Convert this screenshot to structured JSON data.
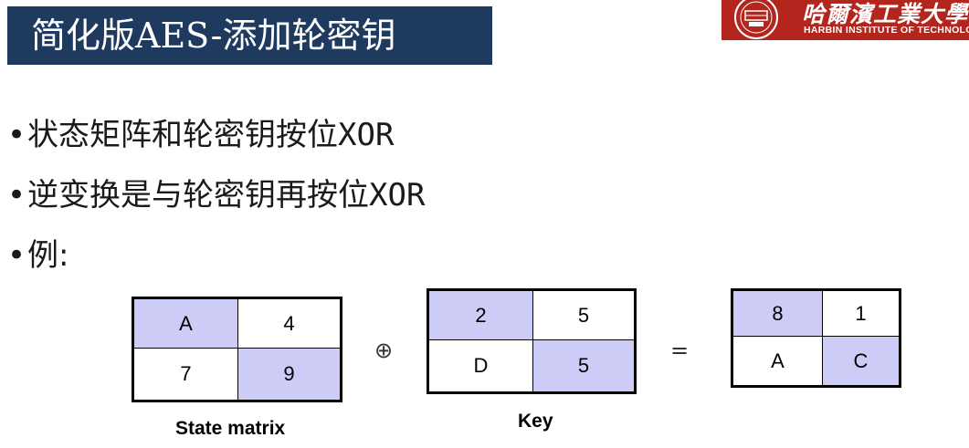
{
  "title": "简化版AES-添加轮密钥",
  "logo": {
    "cn": "哈爾濱工業大學",
    "en": "HARBIN INSTITUTE OF TECHNOLOGY"
  },
  "bullets": [
    {
      "cn": "状态矩阵和轮密钥按位",
      "en": "XOR"
    },
    {
      "cn": "逆变换是与轮密钥再按位",
      "en": "XOR"
    },
    {
      "cn": "例:",
      "en": ""
    }
  ],
  "bullet_symbol": "•",
  "colors": {
    "title_bg": "#1f3a5f",
    "logo_bg": "#b3261e",
    "highlight": "#ccccf7"
  },
  "matrices": {
    "state": {
      "cells": [
        "A",
        "4",
        "7",
        "9"
      ],
      "caption": "State matrix"
    },
    "key": {
      "cells": [
        "2",
        "5",
        "D",
        "5"
      ],
      "caption": "Key"
    },
    "result": {
      "cells": [
        "8",
        "1",
        "A",
        "C"
      ],
      "caption": ""
    }
  },
  "operators": {
    "xor": "⊕",
    "equals": "="
  }
}
